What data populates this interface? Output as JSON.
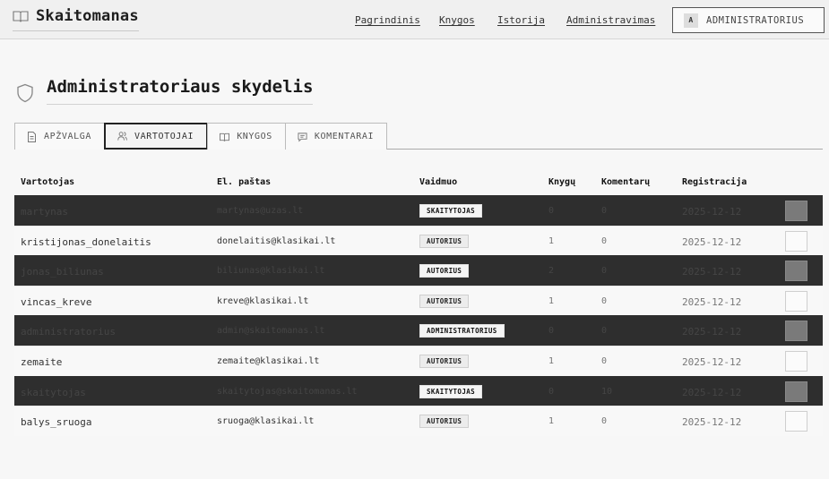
{
  "header": {
    "brand": "Skaitomanas",
    "nav": [
      "Pagrindinis",
      "Knygos",
      "Istorija",
      "Administravimas"
    ],
    "user_initial": "A",
    "user_label": "ADMINISTRATORIUS"
  },
  "page": {
    "title": "Administratoriaus skydelis"
  },
  "tabs": [
    {
      "label": "APŽVALGA",
      "icon": "document-icon"
    },
    {
      "label": "VARTOTOJAI",
      "icon": "users-icon"
    },
    {
      "label": "KNYGOS",
      "icon": "book-icon"
    },
    {
      "label": "KOMENTARAI",
      "icon": "comment-icon"
    }
  ],
  "active_tab": "VARTOTOJAI",
  "table": {
    "columns": [
      "Vartotojas",
      "El. paštas",
      "Vaidmuo",
      "Knygų",
      "Komentarų",
      "Registracija"
    ],
    "rows": [
      {
        "user": "martynas",
        "email": "martynas@uzas.lt",
        "role": "SKAITYTOJAS",
        "books": "0",
        "comments": "0",
        "registered": "2025-12-12",
        "style": "dark"
      },
      {
        "user": "kristijonas_donelaitis",
        "email": "donelaitis@klasikai.lt",
        "role": "AUTORIUS",
        "books": "1",
        "comments": "0",
        "registered": "2025-12-12",
        "style": "light"
      },
      {
        "user": "jonas_biliunas",
        "email": "biliunas@klasikai.lt",
        "role": "AUTORIUS",
        "books": "2",
        "comments": "0",
        "registered": "2025-12-12",
        "style": "dark"
      },
      {
        "user": "vincas_kreve",
        "email": "kreve@klasikai.lt",
        "role": "AUTORIUS",
        "books": "1",
        "comments": "0",
        "registered": "2025-12-12",
        "style": "light"
      },
      {
        "user": "administratorius",
        "email": "admin@skaitomanas.lt",
        "role": "ADMINISTRATORIUS",
        "books": "0",
        "comments": "0",
        "registered": "2025-12-12",
        "style": "dark"
      },
      {
        "user": "zemaite",
        "email": "zemaite@klasikai.lt",
        "role": "AUTORIUS",
        "books": "1",
        "comments": "0",
        "registered": "2025-12-12",
        "style": "light"
      },
      {
        "user": "skaitytojas",
        "email": "skaitytojas@skaitomanas.lt",
        "role": "SKAITYTOJAS",
        "books": "0",
        "comments": "10",
        "registered": "2025-12-12",
        "style": "dark"
      },
      {
        "user": "balys_sruoga",
        "email": "sruoga@klasikai.lt",
        "role": "AUTORIUS",
        "books": "1",
        "comments": "0",
        "registered": "2025-12-12",
        "style": "light"
      }
    ]
  }
}
